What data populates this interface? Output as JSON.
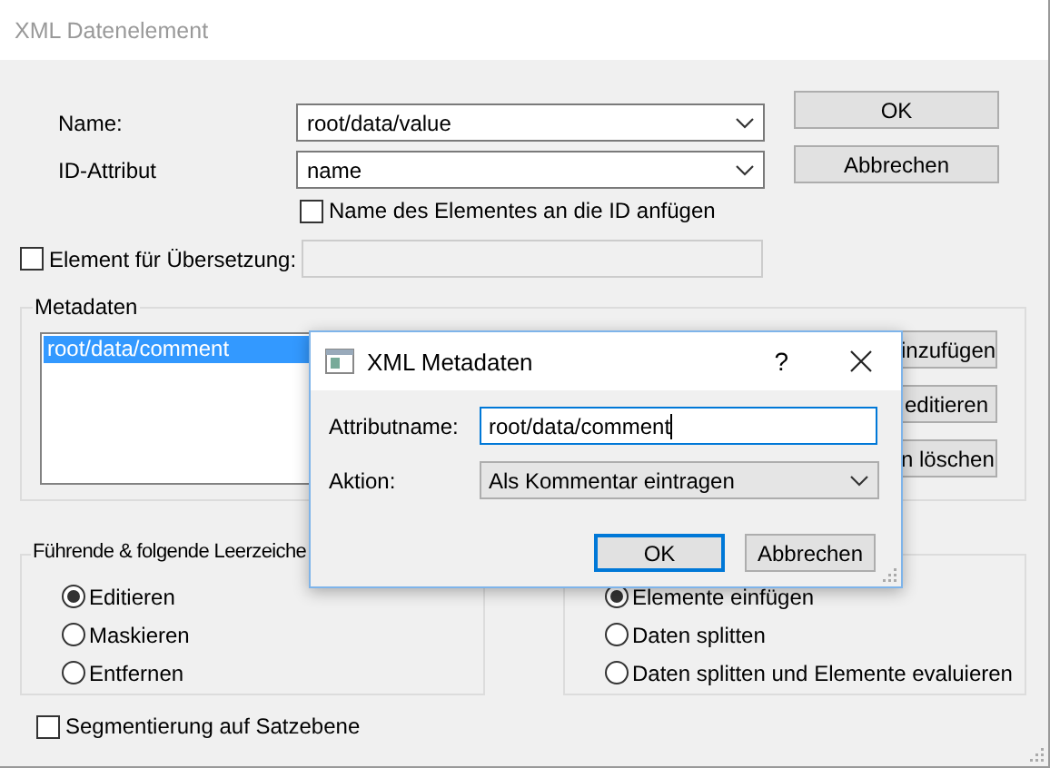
{
  "window": {
    "title": "XML Datenelement"
  },
  "fields": [
    {
      "label": "Name:",
      "value": "root/data/value"
    },
    {
      "label": "ID-Attribut",
      "value": "name"
    }
  ],
  "append_name": {
    "label": "Name des Elementes an die ID anfügen",
    "checked": false
  },
  "translation": {
    "label": "Element für Übersetzung:",
    "checked": false,
    "disabled": true
  },
  "buttons": [
    "OK",
    "Abbrechen"
  ],
  "metadata": {
    "title": "Metadaten",
    "items": [
      {
        "label": "root/data/comment",
        "selected": true
      }
    ],
    "buttons": [
      "inzufügen",
      "editieren",
      "n löschen"
    ]
  },
  "whitespace_group": {
    "title": "Führende & folgende Leerzeiche",
    "options": [
      {
        "label": "Editieren",
        "selected": true
      },
      {
        "label": "Maskieren",
        "selected": false
      },
      {
        "label": "Entfernen",
        "selected": false
      }
    ]
  },
  "split_group": {
    "options": [
      {
        "label": "Elemente einfügen",
        "selected": true
      },
      {
        "label": "Daten splitten",
        "selected": false
      },
      {
        "label": "Daten splitten und Elemente evaluieren",
        "selected": false
      }
    ]
  },
  "segmentation": {
    "label": "Segmentierung auf Satzebene",
    "checked": false
  },
  "overlay_dialog": {
    "title": "XML Metadaten",
    "help": "?",
    "fields": [
      {
        "label": "Attributname:",
        "value": "root/data/comment",
        "kind": "text"
      },
      {
        "label": "Aktion:",
        "value": "Als Kommentar eintragen",
        "kind": "select"
      }
    ],
    "buttons": [
      {
        "label": "OK",
        "default": true
      },
      {
        "label": "Abbrechen",
        "default": false
      }
    ]
  }
}
